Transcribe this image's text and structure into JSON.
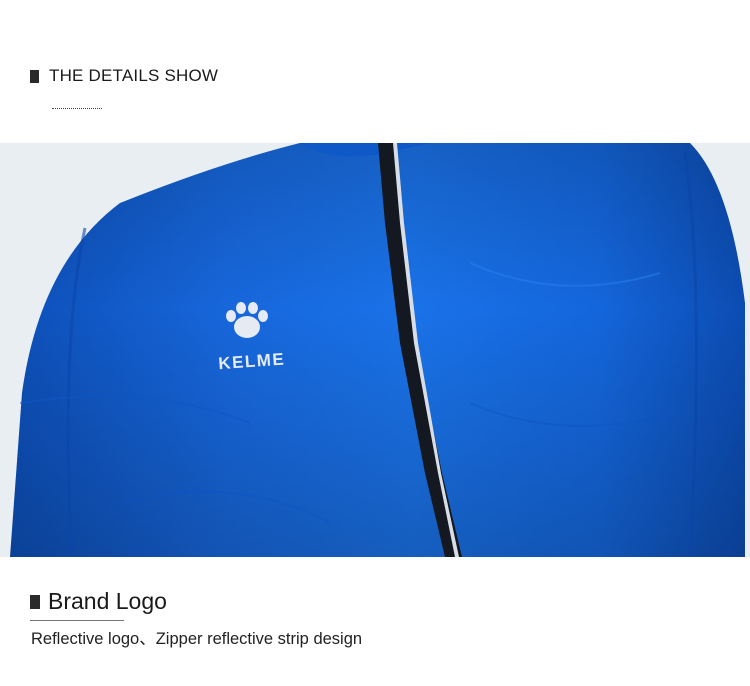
{
  "header": {
    "title": "THE DETAILS SHOW"
  },
  "feature": {
    "title": "Brand Logo",
    "description": "Reflective logo、Zipper reflective strip design"
  },
  "photo": {
    "brand_text": "KELME",
    "jacket_color": "#1565d8",
    "logo_color": "#e6ebf3",
    "zipper_color": "#141821",
    "reflective_strip_color": "#d8dde6",
    "background_color": "#e9eef3"
  }
}
